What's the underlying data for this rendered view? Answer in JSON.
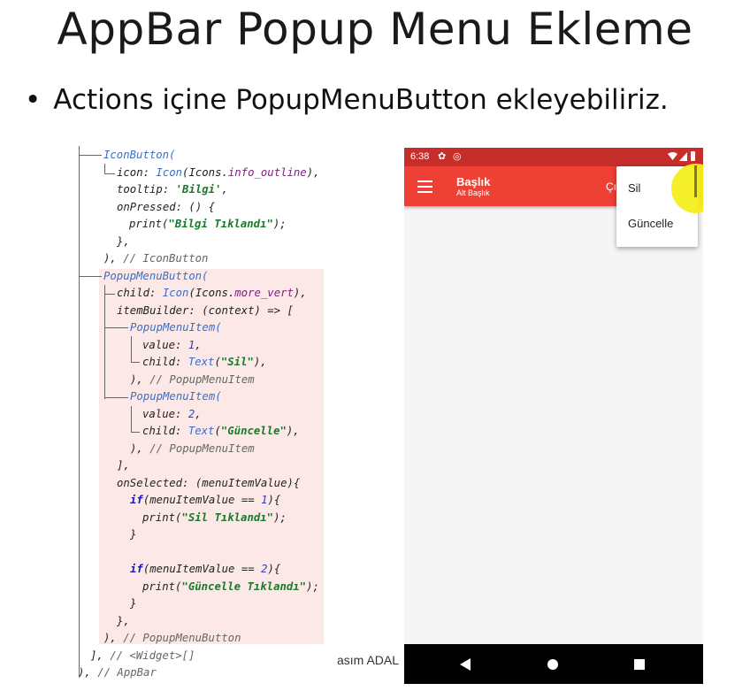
{
  "slide": {
    "title": "AppBar Popup Menu Ekleme",
    "bullet": "Actions içine PopupMenuButton ekleyebiliriz.",
    "footer_author": "asım ADAL"
  },
  "code": {
    "l1": "IconButton(",
    "l2a": "icon: ",
    "l2b": "Icon",
    "l2c": "(Icons.",
    "l2d": "info_outline",
    "l2e": "),",
    "l3a": "tooltip: ",
    "l3b": "'Bilgi'",
    "l3c": ",",
    "l4": "onPressed: () {",
    "l5a": "print(",
    "l5b": "\"Bilgi Tıklandı\"",
    "l5c": ");",
    "l6": "},",
    "l7a": "), ",
    "l7b": "// IconButton",
    "l8": "PopupMenuButton(",
    "l9a": "child: ",
    "l9b": "Icon",
    "l9c": "(Icons.",
    "l9d": "more_vert",
    "l9e": "),",
    "l10": "itemBuilder: (context) => [",
    "l11": "PopupMenuItem(",
    "l12a": "value: ",
    "l12b": "1",
    "l12c": ",",
    "l13a": "child: ",
    "l13b": "Text",
    "l13c": "(",
    "l13d": "\"Sil\"",
    "l13e": "),",
    "l14a": "), ",
    "l14b": "// PopupMenuItem",
    "l15": "PopupMenuItem(",
    "l16a": "value: ",
    "l16b": "2",
    "l16c": ",",
    "l17a": "child: ",
    "l17b": "Text",
    "l17c": "(",
    "l17d": "\"Güncelle\"",
    "l17e": "),",
    "l18a": "), ",
    "l18b": "// PopupMenuItem",
    "l19": "],",
    "l20": "onSelected: (menuItemValue){",
    "l21a": "if",
    "l21b": "(",
    "l21c": "menuItemValue",
    "l21d": " == ",
    "l21e": "1",
    "l21f": "){",
    "l22a": "print(",
    "l22b": "\"Sil Tıklandı\"",
    "l22c": ");",
    "l23": "}",
    "l24a": "if",
    "l24b": "(",
    "l24c": "menuItemValue",
    "l24d": " == ",
    "l24e": "2",
    "l24f": "){",
    "l25a": "print(",
    "l25b": "\"Güncelle Tıklandı\"",
    "l25c": ");",
    "l26": "}",
    "l27": "},",
    "l28a": "), ",
    "l28b": "// PopupMenuButton",
    "l29a": "], ",
    "l29b": "// <Widget>[]",
    "l30a": "), ",
    "l30b": "// AppBar"
  },
  "phone": {
    "status_time": "6:38",
    "appbar_title": "Başlık",
    "appbar_subtitle": "Alt Başlık",
    "appbar_action_partial": "Çı",
    "menu": [
      "Sil",
      "Güncelle"
    ],
    "colors": {
      "status": "#c62e2b",
      "appbar": "#ef4036",
      "touch": "#f4ee1e"
    }
  }
}
